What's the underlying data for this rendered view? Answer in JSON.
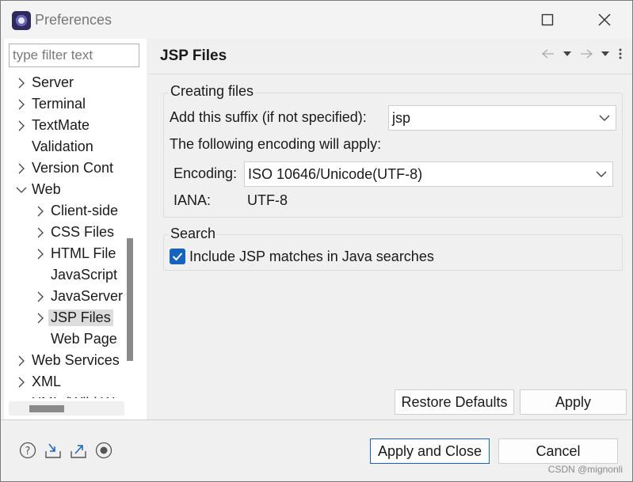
{
  "window": {
    "title": "Preferences",
    "icon": "eclipse-icon"
  },
  "filter": {
    "placeholder": "type filter text"
  },
  "tree": [
    {
      "label": "Server",
      "chevron": "right",
      "indent": 0
    },
    {
      "label": "Terminal",
      "chevron": "right",
      "indent": 0
    },
    {
      "label": "TextMate",
      "chevron": "right",
      "indent": 0
    },
    {
      "label": "Validation",
      "chevron": "none",
      "indent": 0
    },
    {
      "label": "Version Cont",
      "chevron": "right",
      "indent": 0
    },
    {
      "label": "Web",
      "chevron": "down",
      "indent": 0
    },
    {
      "label": "Client-side",
      "chevron": "right",
      "indent": 1
    },
    {
      "label": "CSS Files",
      "chevron": "right",
      "indent": 1
    },
    {
      "label": "HTML File",
      "chevron": "right",
      "indent": 1
    },
    {
      "label": "JavaScript",
      "chevron": "none",
      "indent": 1
    },
    {
      "label": "JavaServer",
      "chevron": "right",
      "indent": 1
    },
    {
      "label": "JSP Files",
      "chevron": "right",
      "indent": 1,
      "selected": true
    },
    {
      "label": "Web Page",
      "chevron": "none",
      "indent": 1
    },
    {
      "label": "Web Services",
      "chevron": "right",
      "indent": 0
    },
    {
      "label": "XML",
      "chevron": "right",
      "indent": 0
    },
    {
      "label": "XML (Wild W",
      "chevron": "right",
      "indent": 0
    }
  ],
  "page": {
    "title": "JSP Files",
    "creating_files": {
      "title": "Creating files",
      "suffix_label": "Add this suffix (if not specified):",
      "suffix_value": "jsp",
      "encoding_intro": "The following encoding will apply:",
      "encoding_label": "Encoding:",
      "encoding_value": "ISO 10646/Unicode(UTF-8)",
      "iana_label": "IANA:",
      "iana_value": "UTF-8"
    },
    "search": {
      "title": "Search",
      "include_label": "Include JSP matches in Java searches",
      "include_checked": true
    },
    "restore_defaults": "Restore Defaults",
    "apply": "Apply"
  },
  "footer": {
    "apply_and_close": "Apply and Close",
    "cancel": "Cancel",
    "icons": [
      "help-icon",
      "import-icon",
      "export-icon",
      "record-icon"
    ]
  },
  "watermark": "CSDN @mignonli",
  "colors": {
    "accent": "#1565c0",
    "selection": "#dcdcdc"
  }
}
